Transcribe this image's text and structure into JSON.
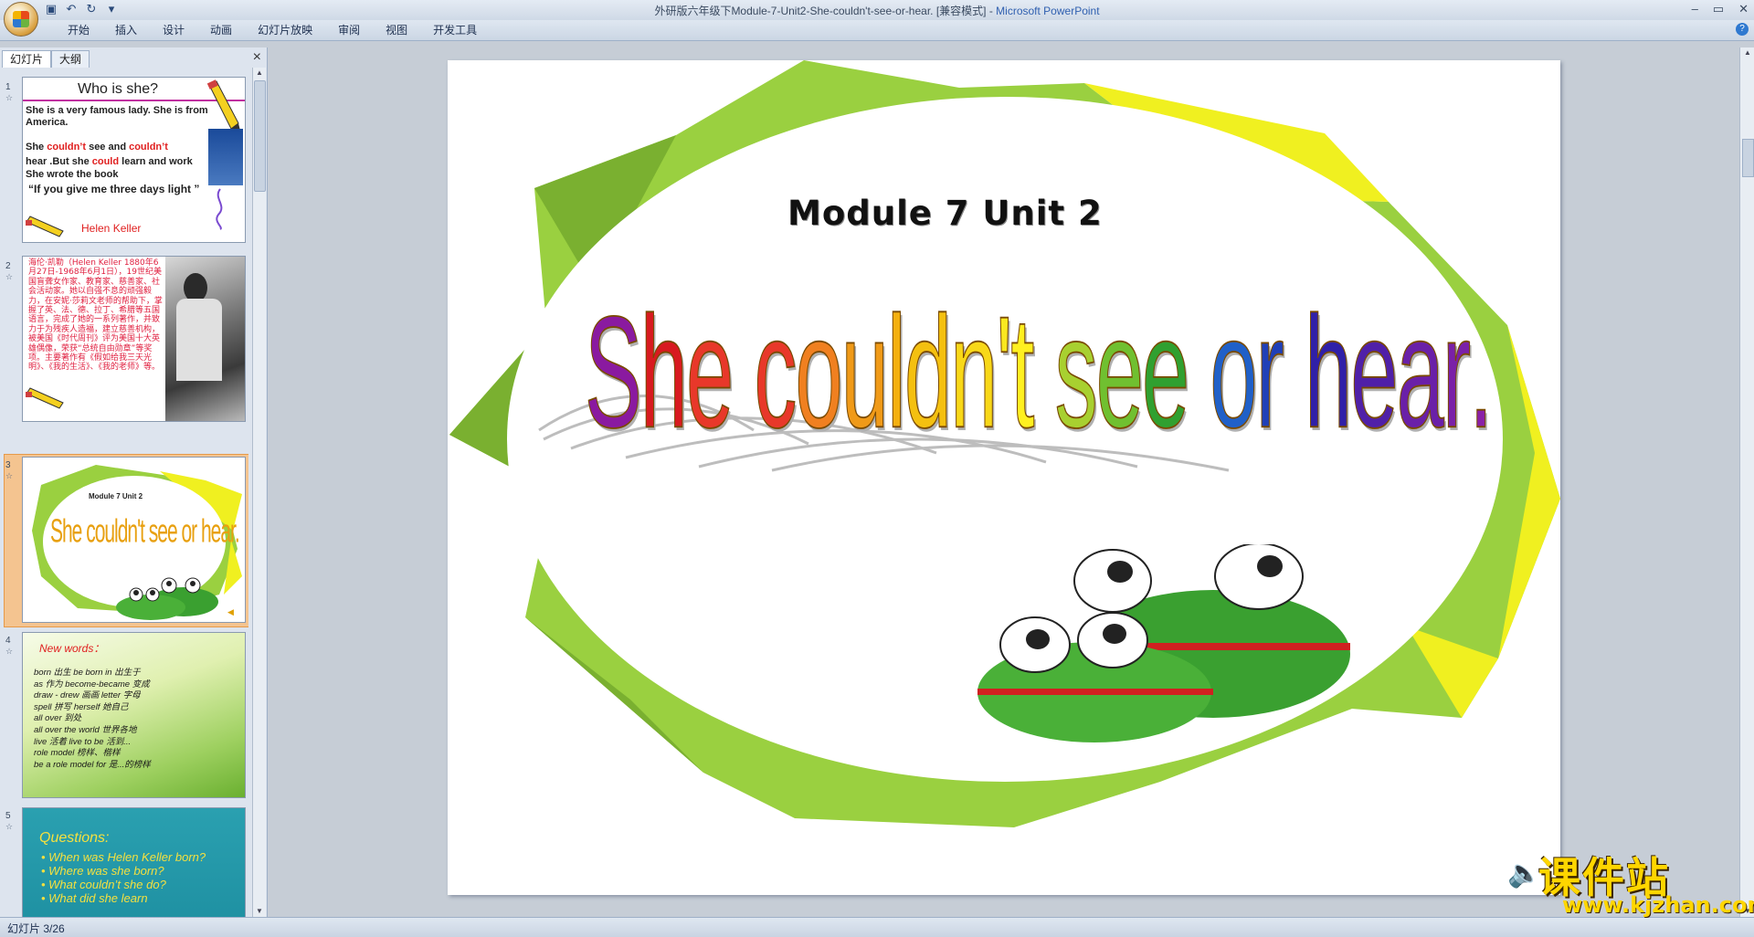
{
  "window": {
    "title": "外研版六年级下Module-7-Unit2-She-couldn't-see-or-hear. [兼容模式] - ",
    "app_name": "Microsoft PowerPoint"
  },
  "ribbon_tabs": [
    "开始",
    "插入",
    "设计",
    "动画",
    "幻灯片放映",
    "审阅",
    "视图",
    "开发工具"
  ],
  "panel": {
    "tab_slides": "幻灯片",
    "tab_outline": "大纲",
    "close": "×"
  },
  "thumb1": {
    "title": "Who is she?",
    "line1": "She is a very famous lady.  She is from America.",
    "line2a": "She ",
    "line2b": "couldn’t",
    "line2c": " see and ",
    "line2d": "couldn’t",
    "line3a": "hear .But she ",
    "line3b": "could",
    "line3c": " learn and work",
    "line4": "She wrote the book",
    "line5": "“If you give me three days light ”",
    "name": "Helen Keller"
  },
  "thumb2": {
    "text": "海伦·凯勒（Helen Keller 1880年6月27日-1968年6月1日），19世纪美国盲聋女作家、教育家、慈善家、社会活动家。她以自强不息的顽强毅力，在安妮·莎莉文老师的帮助下，掌握了英、法、德、拉丁、希腊等五国语言，完成了她的一系列著作，并致力于为残疾人造福，建立慈善机构，被美国《时代周刊》评为美国十大英雄偶像，荣获“总统自由勋章”等奖项。主要著作有《假如给我三天光明》、《我的生活》、《我的老师》等。"
  },
  "thumb3": {
    "module": "Module 7 Unit 2",
    "title": "She couldn't see or hear."
  },
  "thumb4": {
    "heading": "New words：",
    "lines": [
      "born 出生  be born in  出生于",
      "as 作为   become-became 变成",
      "draw - drew 画画    letter 字母",
      "spell 拼写    herself  她自己",
      "all over 到处",
      "all over the world 世界各地",
      "live  活着      live to be 活到...",
      "role model  榜样、楷样",
      "be a role model for 是...的榜样"
    ]
  },
  "thumb5": {
    "heading": "Questions:",
    "lines": [
      "• When was Helen Keller born?",
      "• Where was she born?",
      "• What couldn’t she do?",
      "• What did she learn"
    ]
  },
  "slide_numbers": [
    "1",
    "2",
    "3",
    "4",
    "5"
  ],
  "main_slide": {
    "module": "Module 7 Unit 2",
    "title_letters": [
      {
        "ch": "S",
        "color": "#8a1aa0"
      },
      {
        "ch": "h",
        "color": "#d81a20"
      },
      {
        "ch": "e",
        "color": "#e8382a"
      },
      {
        "ch": " ",
        "color": "#000"
      },
      {
        "ch": "c",
        "color": "#e8382a"
      },
      {
        "ch": "o",
        "color": "#f08020"
      },
      {
        "ch": "u",
        "color": "#f09a18"
      },
      {
        "ch": "l",
        "color": "#f4b010"
      },
      {
        "ch": "d",
        "color": "#f4c010"
      },
      {
        "ch": "n",
        "color": "#f8d818"
      },
      {
        "ch": "'",
        "color": "#fae820"
      },
      {
        "ch": "t",
        "color": "#fff020"
      },
      {
        "ch": " ",
        "color": "#000"
      },
      {
        "ch": "s",
        "color": "#a8d030"
      },
      {
        "ch": "e",
        "color": "#70c030"
      },
      {
        "ch": "e",
        "color": "#30a030"
      },
      {
        "ch": " ",
        "color": "#000"
      },
      {
        "ch": "o",
        "color": "#2060c8"
      },
      {
        "ch": "r",
        "color": "#2040b8"
      },
      {
        "ch": " ",
        "color": "#000"
      },
      {
        "ch": "h",
        "color": "#3020a8"
      },
      {
        "ch": "e",
        "color": "#5020a8"
      },
      {
        "ch": "a",
        "color": "#6a20a8"
      },
      {
        "ch": "r",
        "color": "#7a20a8"
      },
      {
        "ch": ".",
        "color": "#8a20a8"
      }
    ]
  },
  "status": {
    "slide_info": "幻灯片 3/26"
  },
  "watermark": {
    "cn": "课件站",
    "url": "www.kjzhan.com"
  }
}
